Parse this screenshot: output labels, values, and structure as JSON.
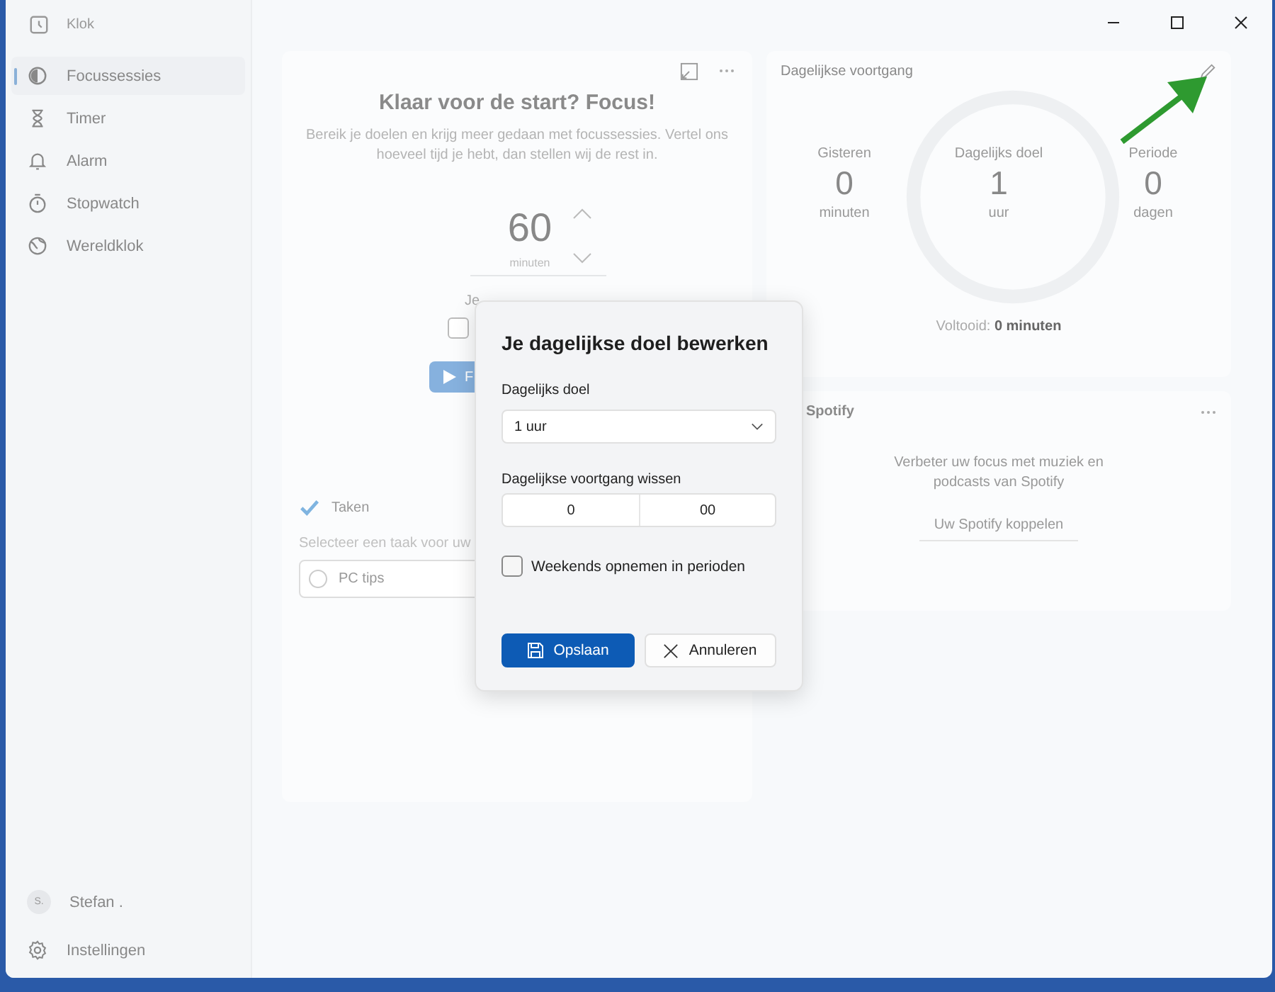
{
  "app": {
    "title": "Klok"
  },
  "sidebar": {
    "items": [
      {
        "label": "Focussessies",
        "kind": "focus",
        "selected": true
      },
      {
        "label": "Timer",
        "kind": "timer",
        "selected": false
      },
      {
        "label": "Alarm",
        "kind": "alarm",
        "selected": false
      },
      {
        "label": "Stopwatch",
        "kind": "stopwatch",
        "selected": false
      },
      {
        "label": "Wereldklok",
        "kind": "worldclock",
        "selected": false
      }
    ],
    "user": {
      "initial": "S.",
      "name": "Stefan ."
    },
    "settings": "Instellingen"
  },
  "focus_card": {
    "title": "Klaar voor de start? Focus!",
    "description": "Bereik je doelen en krijg meer gedaan met focussessies. Vertel ons hoeveel tijd je hebt, dan stellen wij de rest in.",
    "timer": {
      "value": "60",
      "unit": "minuten"
    },
    "partial_label": "Je",
    "skip_breaks_checked": false,
    "start_label": "F"
  },
  "tasks": {
    "title": "Taken",
    "hint": "Selecteer een taak voor uw",
    "items": [
      {
        "label": "PC tips",
        "done": false
      }
    ]
  },
  "progress_card": {
    "title": "Dagelijkse voortgang",
    "level": 0,
    "stats": [
      {
        "label": "Gisteren",
        "value": "0",
        "unit": "minuten"
      },
      {
        "label": "Dagelijks doel",
        "value": "1",
        "unit": "uur"
      },
      {
        "label": "Periode",
        "value": "0",
        "unit": "dagen"
      }
    ],
    "completed": "Voltooid: **0 minuten**"
  },
  "spotify": {
    "title": "Spotify",
    "text": "Verbeter uw focus met muziek en podcasts van Spotify",
    "button": "Uw Spotify koppelen"
  },
  "dialog": {
    "title": "Je dagelijkse doel bewerken",
    "goal_label": "Dagelijks doel",
    "goal_value": "1 uur",
    "clear_label": "Dagelijkse voortgang wissen",
    "hours": "0",
    "minutes": "00",
    "weekends": {
      "label": "Weekends opnemen in perioden",
      "checked": false
    },
    "buttons": [
      {
        "label": "Opslaan",
        "kind": "primary"
      },
      {
        "label": "Annuleren",
        "kind": "secondary"
      }
    ]
  }
}
